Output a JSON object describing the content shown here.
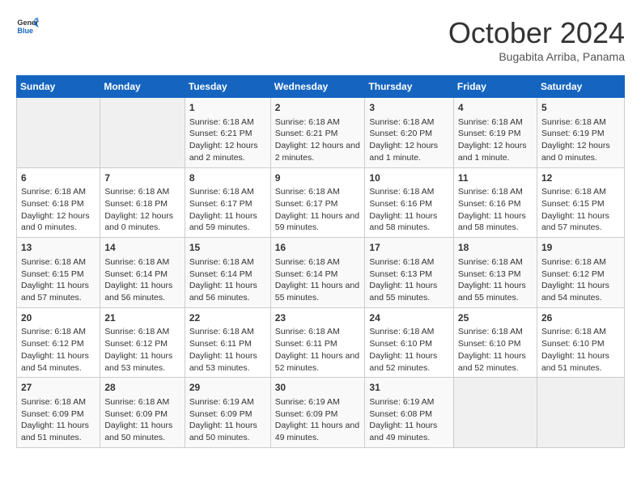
{
  "header": {
    "logo_general": "General",
    "logo_blue": "Blue",
    "month_title": "October 2024",
    "subtitle": "Bugabita Arriba, Panama"
  },
  "days_of_week": [
    "Sunday",
    "Monday",
    "Tuesday",
    "Wednesday",
    "Thursday",
    "Friday",
    "Saturday"
  ],
  "weeks": [
    [
      {
        "day": "",
        "info": ""
      },
      {
        "day": "",
        "info": ""
      },
      {
        "day": "1",
        "info": "Sunrise: 6:18 AM\nSunset: 6:21 PM\nDaylight: 12 hours and 2 minutes."
      },
      {
        "day": "2",
        "info": "Sunrise: 6:18 AM\nSunset: 6:21 PM\nDaylight: 12 hours and 2 minutes."
      },
      {
        "day": "3",
        "info": "Sunrise: 6:18 AM\nSunset: 6:20 PM\nDaylight: 12 hours and 1 minute."
      },
      {
        "day": "4",
        "info": "Sunrise: 6:18 AM\nSunset: 6:19 PM\nDaylight: 12 hours and 1 minute."
      },
      {
        "day": "5",
        "info": "Sunrise: 6:18 AM\nSunset: 6:19 PM\nDaylight: 12 hours and 0 minutes."
      }
    ],
    [
      {
        "day": "6",
        "info": "Sunrise: 6:18 AM\nSunset: 6:18 PM\nDaylight: 12 hours and 0 minutes."
      },
      {
        "day": "7",
        "info": "Sunrise: 6:18 AM\nSunset: 6:18 PM\nDaylight: 12 hours and 0 minutes."
      },
      {
        "day": "8",
        "info": "Sunrise: 6:18 AM\nSunset: 6:17 PM\nDaylight: 11 hours and 59 minutes."
      },
      {
        "day": "9",
        "info": "Sunrise: 6:18 AM\nSunset: 6:17 PM\nDaylight: 11 hours and 59 minutes."
      },
      {
        "day": "10",
        "info": "Sunrise: 6:18 AM\nSunset: 6:16 PM\nDaylight: 11 hours and 58 minutes."
      },
      {
        "day": "11",
        "info": "Sunrise: 6:18 AM\nSunset: 6:16 PM\nDaylight: 11 hours and 58 minutes."
      },
      {
        "day": "12",
        "info": "Sunrise: 6:18 AM\nSunset: 6:15 PM\nDaylight: 11 hours and 57 minutes."
      }
    ],
    [
      {
        "day": "13",
        "info": "Sunrise: 6:18 AM\nSunset: 6:15 PM\nDaylight: 11 hours and 57 minutes."
      },
      {
        "day": "14",
        "info": "Sunrise: 6:18 AM\nSunset: 6:14 PM\nDaylight: 11 hours and 56 minutes."
      },
      {
        "day": "15",
        "info": "Sunrise: 6:18 AM\nSunset: 6:14 PM\nDaylight: 11 hours and 56 minutes."
      },
      {
        "day": "16",
        "info": "Sunrise: 6:18 AM\nSunset: 6:14 PM\nDaylight: 11 hours and 55 minutes."
      },
      {
        "day": "17",
        "info": "Sunrise: 6:18 AM\nSunset: 6:13 PM\nDaylight: 11 hours and 55 minutes."
      },
      {
        "day": "18",
        "info": "Sunrise: 6:18 AM\nSunset: 6:13 PM\nDaylight: 11 hours and 55 minutes."
      },
      {
        "day": "19",
        "info": "Sunrise: 6:18 AM\nSunset: 6:12 PM\nDaylight: 11 hours and 54 minutes."
      }
    ],
    [
      {
        "day": "20",
        "info": "Sunrise: 6:18 AM\nSunset: 6:12 PM\nDaylight: 11 hours and 54 minutes."
      },
      {
        "day": "21",
        "info": "Sunrise: 6:18 AM\nSunset: 6:12 PM\nDaylight: 11 hours and 53 minutes."
      },
      {
        "day": "22",
        "info": "Sunrise: 6:18 AM\nSunset: 6:11 PM\nDaylight: 11 hours and 53 minutes."
      },
      {
        "day": "23",
        "info": "Sunrise: 6:18 AM\nSunset: 6:11 PM\nDaylight: 11 hours and 52 minutes."
      },
      {
        "day": "24",
        "info": "Sunrise: 6:18 AM\nSunset: 6:10 PM\nDaylight: 11 hours and 52 minutes."
      },
      {
        "day": "25",
        "info": "Sunrise: 6:18 AM\nSunset: 6:10 PM\nDaylight: 11 hours and 52 minutes."
      },
      {
        "day": "26",
        "info": "Sunrise: 6:18 AM\nSunset: 6:10 PM\nDaylight: 11 hours and 51 minutes."
      }
    ],
    [
      {
        "day": "27",
        "info": "Sunrise: 6:18 AM\nSunset: 6:09 PM\nDaylight: 11 hours and 51 minutes."
      },
      {
        "day": "28",
        "info": "Sunrise: 6:18 AM\nSunset: 6:09 PM\nDaylight: 11 hours and 50 minutes."
      },
      {
        "day": "29",
        "info": "Sunrise: 6:19 AM\nSunset: 6:09 PM\nDaylight: 11 hours and 50 minutes."
      },
      {
        "day": "30",
        "info": "Sunrise: 6:19 AM\nSunset: 6:09 PM\nDaylight: 11 hours and 49 minutes."
      },
      {
        "day": "31",
        "info": "Sunrise: 6:19 AM\nSunset: 6:08 PM\nDaylight: 11 hours and 49 minutes."
      },
      {
        "day": "",
        "info": ""
      },
      {
        "day": "",
        "info": ""
      }
    ]
  ]
}
